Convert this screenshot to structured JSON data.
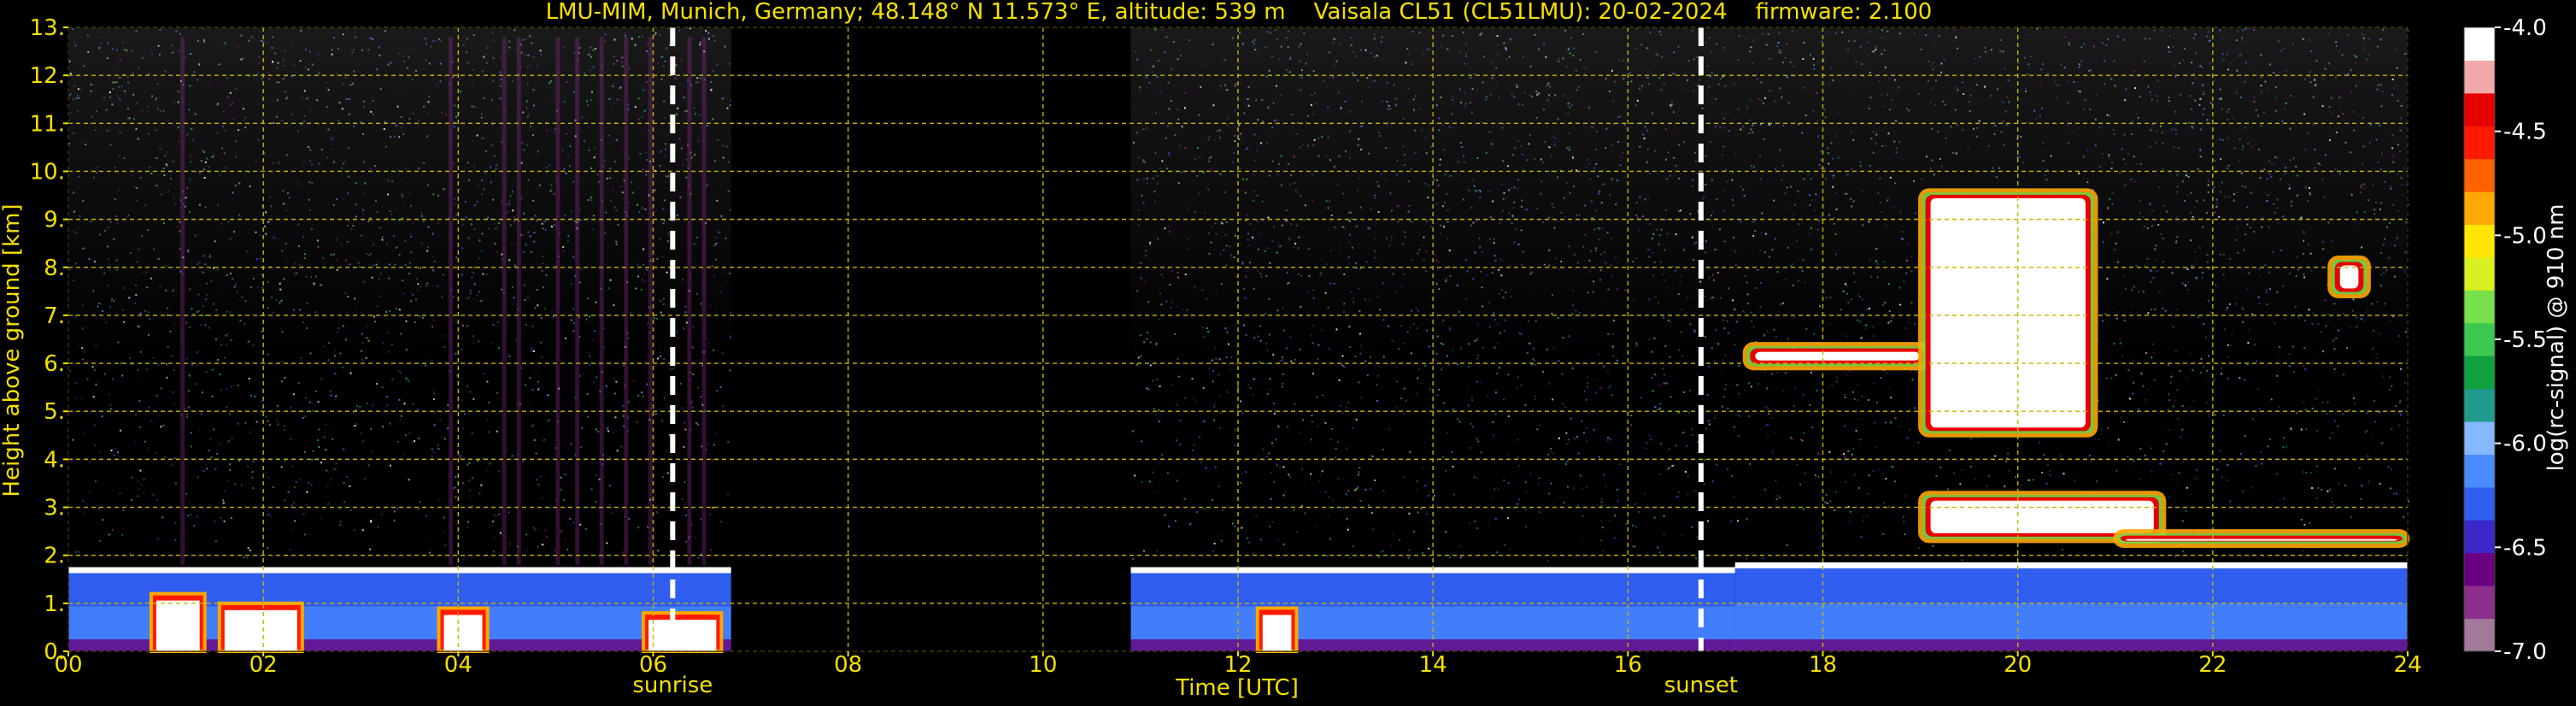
{
  "chart_data": {
    "type": "heatmap",
    "title": "LMU-MIM, Munich, Germany; 48.148° N 11.573° E, altitude: 539 m    Vaisala CL51 (CL51LMU): 20-02-2024    firmware: 2.100",
    "xlabel": "Time [UTC]",
    "ylabel": "Height above ground [km]",
    "colorbar_label": "log(rc-signal) @ 910 nm",
    "xlim": [
      0,
      24
    ],
    "ylim": [
      0,
      13
    ],
    "x_ticks": [
      "00",
      "02",
      "04",
      "06",
      "08",
      "10",
      "12",
      "14",
      "16",
      "18",
      "20",
      "22",
      "24"
    ],
    "y_ticks": [
      "0.",
      "1.",
      "2.",
      "3.",
      "4.",
      "5.",
      "6.",
      "7.",
      "8.",
      "9.",
      "10.",
      "11.",
      "12.",
      "13."
    ],
    "colorbar_range": [
      -7.0,
      -4.0
    ],
    "colorbar_ticks": [
      "-7.0",
      "-6.5",
      "-6.0",
      "-5.5",
      "-5.0",
      "-4.5",
      "-4.0"
    ],
    "grid": true,
    "annotations": [
      {
        "label": "sunrise",
        "time": 6.2
      },
      {
        "label": "sunset",
        "time": 16.75
      }
    ],
    "no_data_interval": [
      6.8,
      10.9
    ],
    "layers": [
      {
        "start": 0.0,
        "end": 6.8,
        "top_km": 1.7
      },
      {
        "start": 10.9,
        "end": 17.1,
        "top_km": 1.7
      },
      {
        "start": 17.1,
        "end": 24.0,
        "top_km": 1.8
      }
    ],
    "clouds": [
      {
        "start": 17.2,
        "end": 19.1,
        "base_km": 5.9,
        "top_km": 6.4
      },
      {
        "start": 19.0,
        "end": 21.5,
        "base_km": 2.3,
        "top_km": 3.3
      },
      {
        "start": 19.0,
        "end": 20.8,
        "base_km": 4.5,
        "top_km": 9.6
      },
      {
        "start": 21.0,
        "end": 24.0,
        "base_km": 2.2,
        "top_km": 2.5
      },
      {
        "start": 23.2,
        "end": 23.6,
        "base_km": 7.4,
        "top_km": 8.2
      }
    ],
    "colors": {
      "text": "#f5e000",
      "grid": "#c8b400",
      "background": "#000000",
      "colormap": [
        "#a07a98",
        "#8c2e8c",
        "#6a0080",
        "#3a28c8",
        "#2f5ef0",
        "#4a8cff",
        "#86b8ff",
        "#1f9a8c",
        "#0fa040",
        "#3cc850",
        "#78e04a",
        "#d8f020",
        "#ffe600",
        "#ffa800",
        "#ff6000",
        "#ff1a00",
        "#e80000",
        "#f0a8a8",
        "#ffffff"
      ]
    }
  }
}
